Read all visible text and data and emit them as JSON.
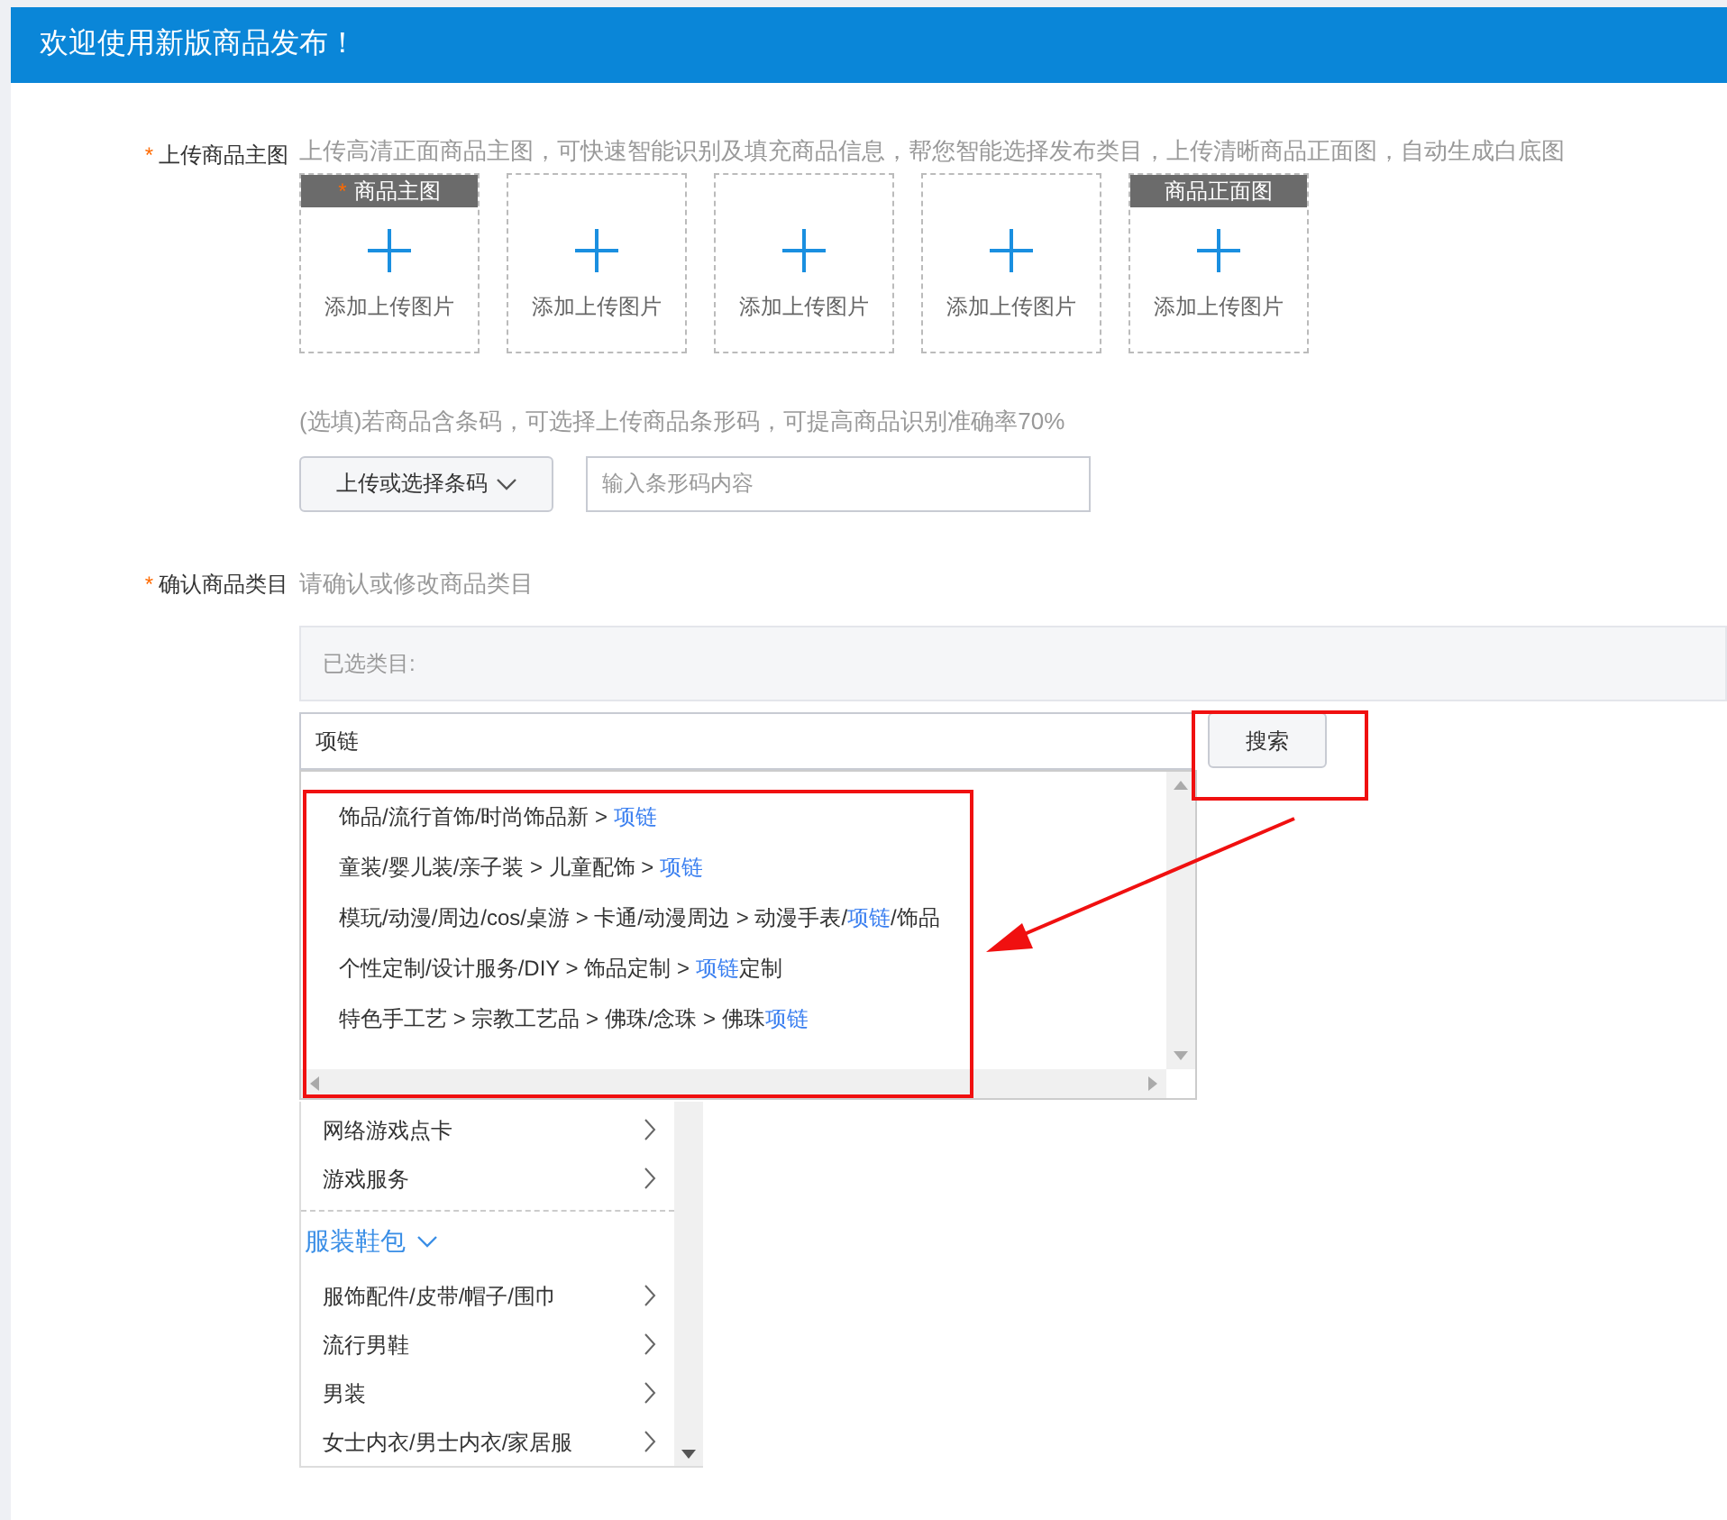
{
  "header": {
    "title": "欢迎使用新版商品发布！"
  },
  "main_image": {
    "required_mark": "*",
    "label": "上传商品主图",
    "hint": "上传高清正面商品主图，可快速智能识别及填充商品信息，帮您智能选择发布类目，上传清晰商品正面图，自动生成白底图",
    "slots": [
      {
        "tag": "商品主图",
        "tag_required": true,
        "label": "添加上传图片"
      },
      {
        "label": "添加上传图片"
      },
      {
        "label": "添加上传图片"
      },
      {
        "label": "添加上传图片"
      },
      {
        "tag": "商品正面图",
        "tag_required": false,
        "label": "添加上传图片"
      }
    ]
  },
  "barcode": {
    "hint": "(选填)若商品含条码，可选择上传商品条形码，可提高商品识别准确率70%",
    "button": "上传或选择条码",
    "placeholder": "输入条形码内容"
  },
  "category": {
    "required_mark": "*",
    "label": "确认商品类目",
    "hint": "请确认或修改商品类目",
    "selected_label": "已选类目:",
    "search_value": "项链",
    "search_button": "搜索",
    "suggestions": [
      [
        {
          "text": "饰品/流行首饰/时尚饰品新 > ",
          "match": false
        },
        {
          "text": "项链",
          "match": true
        }
      ],
      [
        {
          "text": "童装/婴儿装/亲子装 > 儿童配饰 > ",
          "match": false
        },
        {
          "text": "项链",
          "match": true
        }
      ],
      [
        {
          "text": "模玩/动漫/周边/cos/桌游 > 卡通/动漫周边 > 动漫手表/",
          "match": false
        },
        {
          "text": "项链",
          "match": true
        },
        {
          "text": "/饰品",
          "match": false
        }
      ],
      [
        {
          "text": "个性定制/设计服务/DIY > 饰品定制 > ",
          "match": false
        },
        {
          "text": "项链",
          "match": true
        },
        {
          "text": "定制",
          "match": false
        }
      ],
      [
        {
          "text": "特色手工艺 > 宗教工艺品 > 佛珠/念珠 > 佛珠",
          "match": false
        },
        {
          "text": "项链",
          "match": true
        }
      ]
    ],
    "tree": [
      {
        "kind": "item",
        "label": "网络游戏点卡"
      },
      {
        "kind": "item",
        "label": "游戏服务"
      },
      {
        "kind": "group",
        "label": "服装鞋包",
        "expanded": true
      },
      {
        "kind": "item",
        "label": "服饰配件/皮带/帽子/围巾"
      },
      {
        "kind": "item",
        "label": "流行男鞋"
      },
      {
        "kind": "item",
        "label": "男装"
      },
      {
        "kind": "item",
        "label": "女士内衣/男士内衣/家居服"
      }
    ]
  }
}
